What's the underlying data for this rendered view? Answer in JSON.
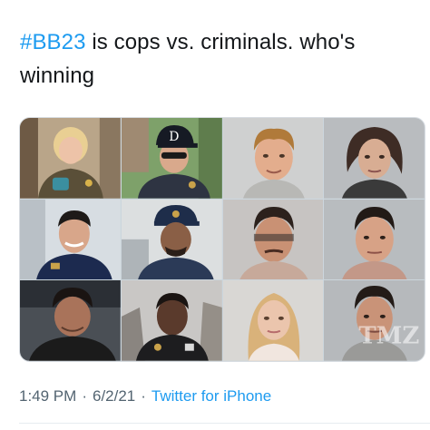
{
  "tweet": {
    "hashtag": "#BB23",
    "text_after_hashtag": " is cops vs. criminals. who's",
    "text_line_2": "winning",
    "time": "1:49 PM",
    "separator": "·",
    "date": "6/2/21",
    "source": "Twitter for iPhone"
  },
  "media": {
    "photos": [
      {
        "name": "photo-1",
        "kind": "officer portrait",
        "cap_text": ""
      },
      {
        "name": "photo-2",
        "kind": "officer portrait",
        "cap_text": "D"
      },
      {
        "name": "photo-3",
        "kind": "mugshot",
        "cap_text": ""
      },
      {
        "name": "photo-4",
        "kind": "mugshot",
        "cap_text": ""
      },
      {
        "name": "photo-5",
        "kind": "officer portrait",
        "cap_text": ""
      },
      {
        "name": "photo-6",
        "kind": "officer portrait",
        "cap_text": ""
      },
      {
        "name": "photo-7",
        "kind": "mugshot",
        "cap_text": ""
      },
      {
        "name": "photo-8",
        "kind": "mugshot",
        "cap_text": ""
      },
      {
        "name": "photo-9",
        "kind": "officer portrait",
        "cap_text": ""
      },
      {
        "name": "photo-10",
        "kind": "officer portrait",
        "cap_text": ""
      },
      {
        "name": "photo-11",
        "kind": "mugshot",
        "cap_text": ""
      },
      {
        "name": "photo-12",
        "kind": "mugshot",
        "cap_text": ""
      }
    ],
    "watermark": "TMZ"
  },
  "colors": {
    "text": "#14171a",
    "link": "#1d9bf0",
    "muted": "#536471"
  }
}
